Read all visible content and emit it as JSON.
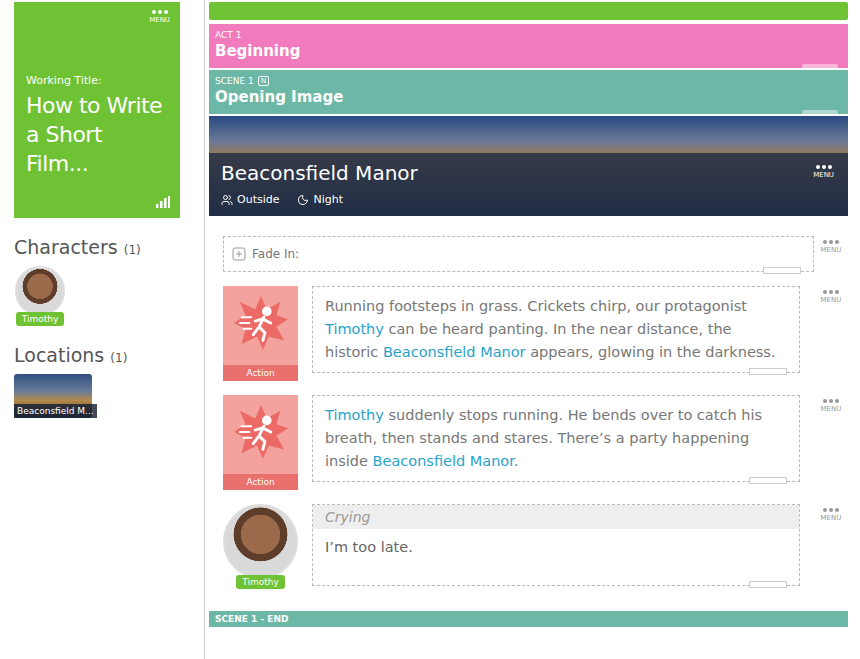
{
  "menu_label": "MENU",
  "project": {
    "working_title_label": "Working Title:",
    "title": "How to Write a Short Film..."
  },
  "characters": {
    "heading": "Characters",
    "count": "(1)",
    "items": [
      {
        "name": "Timothy"
      }
    ]
  },
  "locations": {
    "heading": "Locations",
    "count": "(1)",
    "items": [
      {
        "name": "Beaconsfield M..."
      }
    ]
  },
  "act": {
    "label": "ACT 1",
    "title": "Beginning"
  },
  "scene": {
    "label": "SCENE 1",
    "badge": "N",
    "title": "Opening Image",
    "end_label": "SCENE 1 - END"
  },
  "location_banner": {
    "name": "Beaconsfield Manor",
    "setting": "Outside",
    "time": "Night"
  },
  "blocks": [
    {
      "kind": "transition",
      "text": "Fade In:"
    },
    {
      "kind": "action",
      "label": "Action",
      "segments": [
        {
          "text": "Running footsteps in grass. Crickets chirp, our protagonist ",
          "link": false
        },
        {
          "text": "Timothy",
          "link": true
        },
        {
          "text": " can be heard panting. In the near distance, the historic ",
          "link": false
        },
        {
          "text": "Beaconsfield Manor",
          "link": true
        },
        {
          "text": " appears, glowing in the darkness.",
          "link": false
        }
      ]
    },
    {
      "kind": "action",
      "label": "Action",
      "segments": [
        {
          "text": "Timothy",
          "link": true
        },
        {
          "text": " suddenly stops running. He bends over to catch his breath, then stands and stares. There’s a party happening inside ",
          "link": false
        },
        {
          "text": "Beaconsfield Manor",
          "link": true
        },
        {
          "text": ".",
          "link": false
        }
      ]
    },
    {
      "kind": "dialogue",
      "character": "Timothy",
      "parenthetical": "Crying",
      "text": "I’m too late."
    }
  ]
}
